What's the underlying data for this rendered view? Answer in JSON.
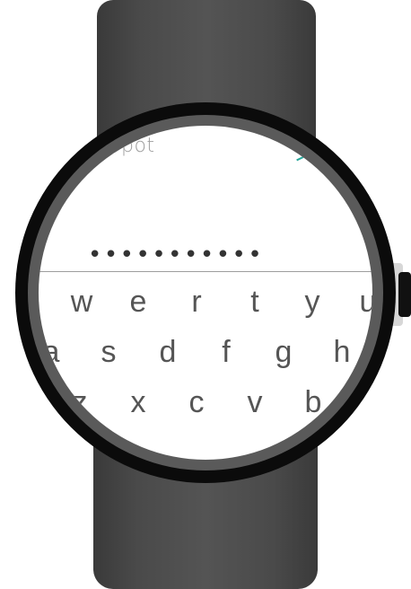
{
  "input": {
    "prompt_text": "pot",
    "masked_value": "•••••••••••"
  },
  "keyboard": {
    "row1": [
      "w",
      "e",
      "r",
      "t",
      "y",
      "u"
    ],
    "row2": [
      "a",
      "s",
      "d",
      "f",
      "g",
      "h"
    ],
    "row3": [
      "z",
      "x",
      "c",
      "v",
      "b"
    ]
  },
  "colors": {
    "band": "#4a4a4a",
    "bezel": "#0b0b0b",
    "accent": "#26a69a",
    "screen": "#ffffff"
  }
}
